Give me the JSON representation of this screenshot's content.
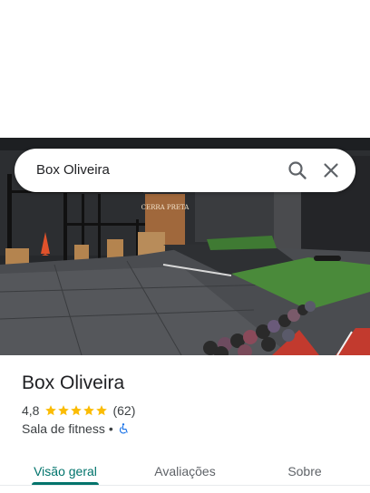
{
  "search": {
    "query": "Box Oliveira"
  },
  "hero": {
    "sign_text": "CERRA PRETA"
  },
  "place": {
    "name": "Box Oliveira",
    "rating": "4,8",
    "stars": 5,
    "review_count": "(62)",
    "category": "Sala de fitness",
    "separator": "•"
  },
  "tabs": [
    {
      "label": "Visão geral",
      "active": true
    },
    {
      "label": "Avaliações",
      "active": false
    },
    {
      "label": "Sobre",
      "active": false
    }
  ],
  "colors": {
    "accent": "#00736b",
    "star": "#fbbc04",
    "accessibility": "#1a73e8",
    "turf": "#4a8a3a"
  },
  "icons": [
    "search-icon",
    "close-icon",
    "star-icon",
    "wheelchair-icon"
  ]
}
